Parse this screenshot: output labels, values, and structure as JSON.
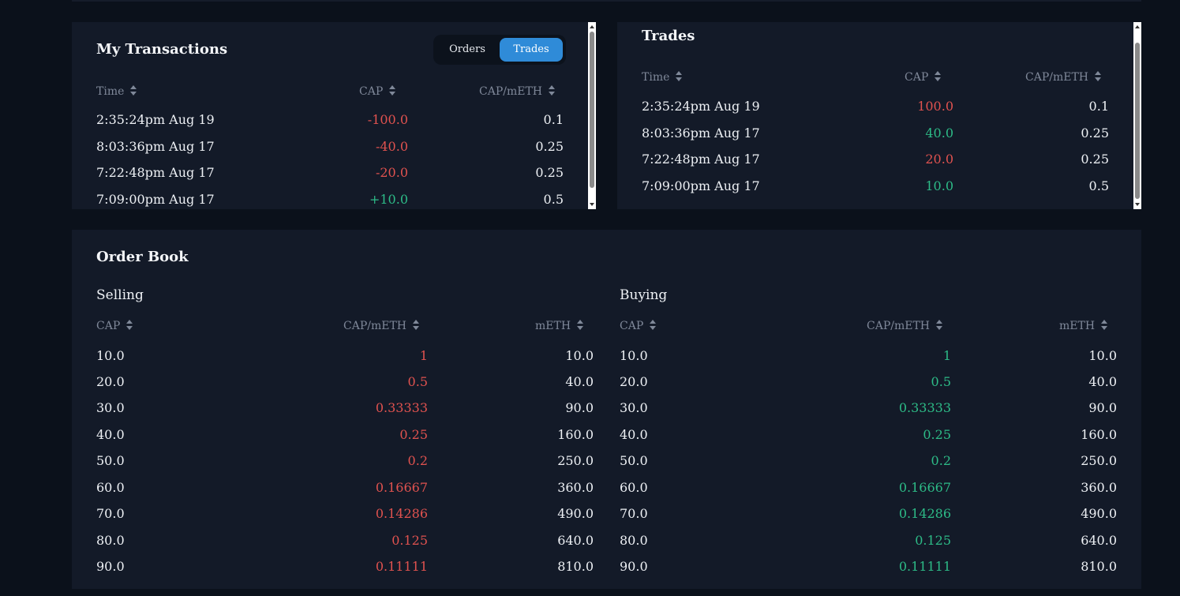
{
  "my_transactions": {
    "title": "My Transactions",
    "toggle": {
      "orders_label": "Orders",
      "trades_label": "Trades",
      "active": "Trades"
    },
    "headers": {
      "time": "Time",
      "cap": "CAP",
      "price": "CAP/mETH"
    },
    "rows": [
      {
        "time": "2:35:24pm Aug 19",
        "cap": "-100.0",
        "price": "0.1",
        "side": "sell"
      },
      {
        "time": "8:03:36pm Aug 17",
        "cap": "-40.0",
        "price": "0.25",
        "side": "sell"
      },
      {
        "time": "7:22:48pm Aug 17",
        "cap": "-20.0",
        "price": "0.25",
        "side": "sell"
      },
      {
        "time": "7:09:00pm Aug 17",
        "cap": "+10.0",
        "price": "0.5",
        "side": "buy"
      }
    ]
  },
  "trades": {
    "title": "Trades",
    "headers": {
      "time": "Time",
      "cap": "CAP",
      "price": "CAP/mETH"
    },
    "rows": [
      {
        "time": "2:35:24pm Aug 19",
        "cap": "100.0",
        "price": "0.1",
        "side": "sell"
      },
      {
        "time": "8:03:36pm Aug 17",
        "cap": "40.0",
        "price": "0.25",
        "side": "buy"
      },
      {
        "time": "7:22:48pm Aug 17",
        "cap": "20.0",
        "price": "0.25",
        "side": "sell"
      },
      {
        "time": "7:09:00pm Aug 17",
        "cap": "10.0",
        "price": "0.5",
        "side": "buy"
      }
    ]
  },
  "order_book": {
    "title": "Order Book",
    "selling": {
      "label": "Selling",
      "headers": {
        "cap": "CAP",
        "price": "CAP/mETH",
        "meth": "mETH"
      },
      "rows": [
        {
          "cap": "10.0",
          "price": "1",
          "meth": "10.0"
        },
        {
          "cap": "20.0",
          "price": "0.5",
          "meth": "40.0"
        },
        {
          "cap": "30.0",
          "price": "0.33333",
          "meth": "90.0"
        },
        {
          "cap": "40.0",
          "price": "0.25",
          "meth": "160.0"
        },
        {
          "cap": "50.0",
          "price": "0.2",
          "meth": "250.0"
        },
        {
          "cap": "60.0",
          "price": "0.16667",
          "meth": "360.0"
        },
        {
          "cap": "70.0",
          "price": "0.14286",
          "meth": "490.0"
        },
        {
          "cap": "80.0",
          "price": "0.125",
          "meth": "640.0"
        },
        {
          "cap": "90.0",
          "price": "0.11111",
          "meth": "810.0"
        }
      ]
    },
    "buying": {
      "label": "Buying",
      "headers": {
        "cap": "CAP",
        "price": "CAP/mETH",
        "meth": "mETH"
      },
      "rows": [
        {
          "cap": "10.0",
          "price": "1",
          "meth": "10.0"
        },
        {
          "cap": "20.0",
          "price": "0.5",
          "meth": "40.0"
        },
        {
          "cap": "30.0",
          "price": "0.33333",
          "meth": "90.0"
        },
        {
          "cap": "40.0",
          "price": "0.25",
          "meth": "160.0"
        },
        {
          "cap": "50.0",
          "price": "0.2",
          "meth": "250.0"
        },
        {
          "cap": "60.0",
          "price": "0.16667",
          "meth": "360.0"
        },
        {
          "cap": "70.0",
          "price": "0.14286",
          "meth": "490.0"
        },
        {
          "cap": "80.0",
          "price": "0.125",
          "meth": "640.0"
        },
        {
          "cap": "90.0",
          "price": "0.11111",
          "meth": "810.0"
        }
      ]
    }
  },
  "colors": {
    "sell": "#e0524f",
    "buy": "#2dbb87",
    "accent": "#2f8bd8",
    "panel": "#131a28",
    "background": "#0b111b"
  },
  "icons": {
    "sort": "sort-icon",
    "scroll_up": "scroll-up-arrow-icon",
    "scroll_down": "scroll-down-arrow-icon"
  }
}
